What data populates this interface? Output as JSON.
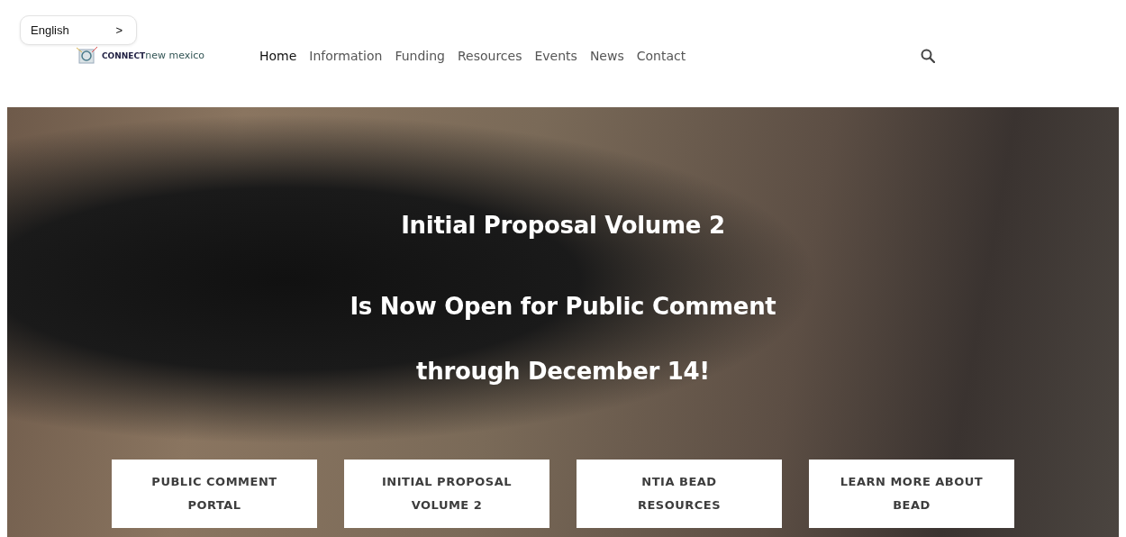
{
  "language_selector": {
    "label": "English",
    "arrow": ">"
  },
  "logo": {
    "text": "**CONNECT**new mexico"
  },
  "nav": [
    {
      "label": "Home",
      "selected": true
    },
    {
      "label": "Information",
      "selected": false
    },
    {
      "label": "Funding",
      "selected": false
    },
    {
      "label": "Resources",
      "selected": false
    },
    {
      "label": "Events",
      "selected": false
    },
    {
      "label": "News",
      "selected": false
    },
    {
      "label": "Contact",
      "selected": false
    }
  ],
  "hero": {
    "headings": [
      "Initial Proposal Volume 2",
      "Is Now Open for Public Comment",
      "through December 14!"
    ],
    "buttons": [
      "PUBLIC COMMENT PORTAL",
      "INITIAL PROPOSAL VOLUME 2",
      "NTIA BEAD RESOURCES",
      "LEARN MORE ABOUT BEAD"
    ]
  }
}
